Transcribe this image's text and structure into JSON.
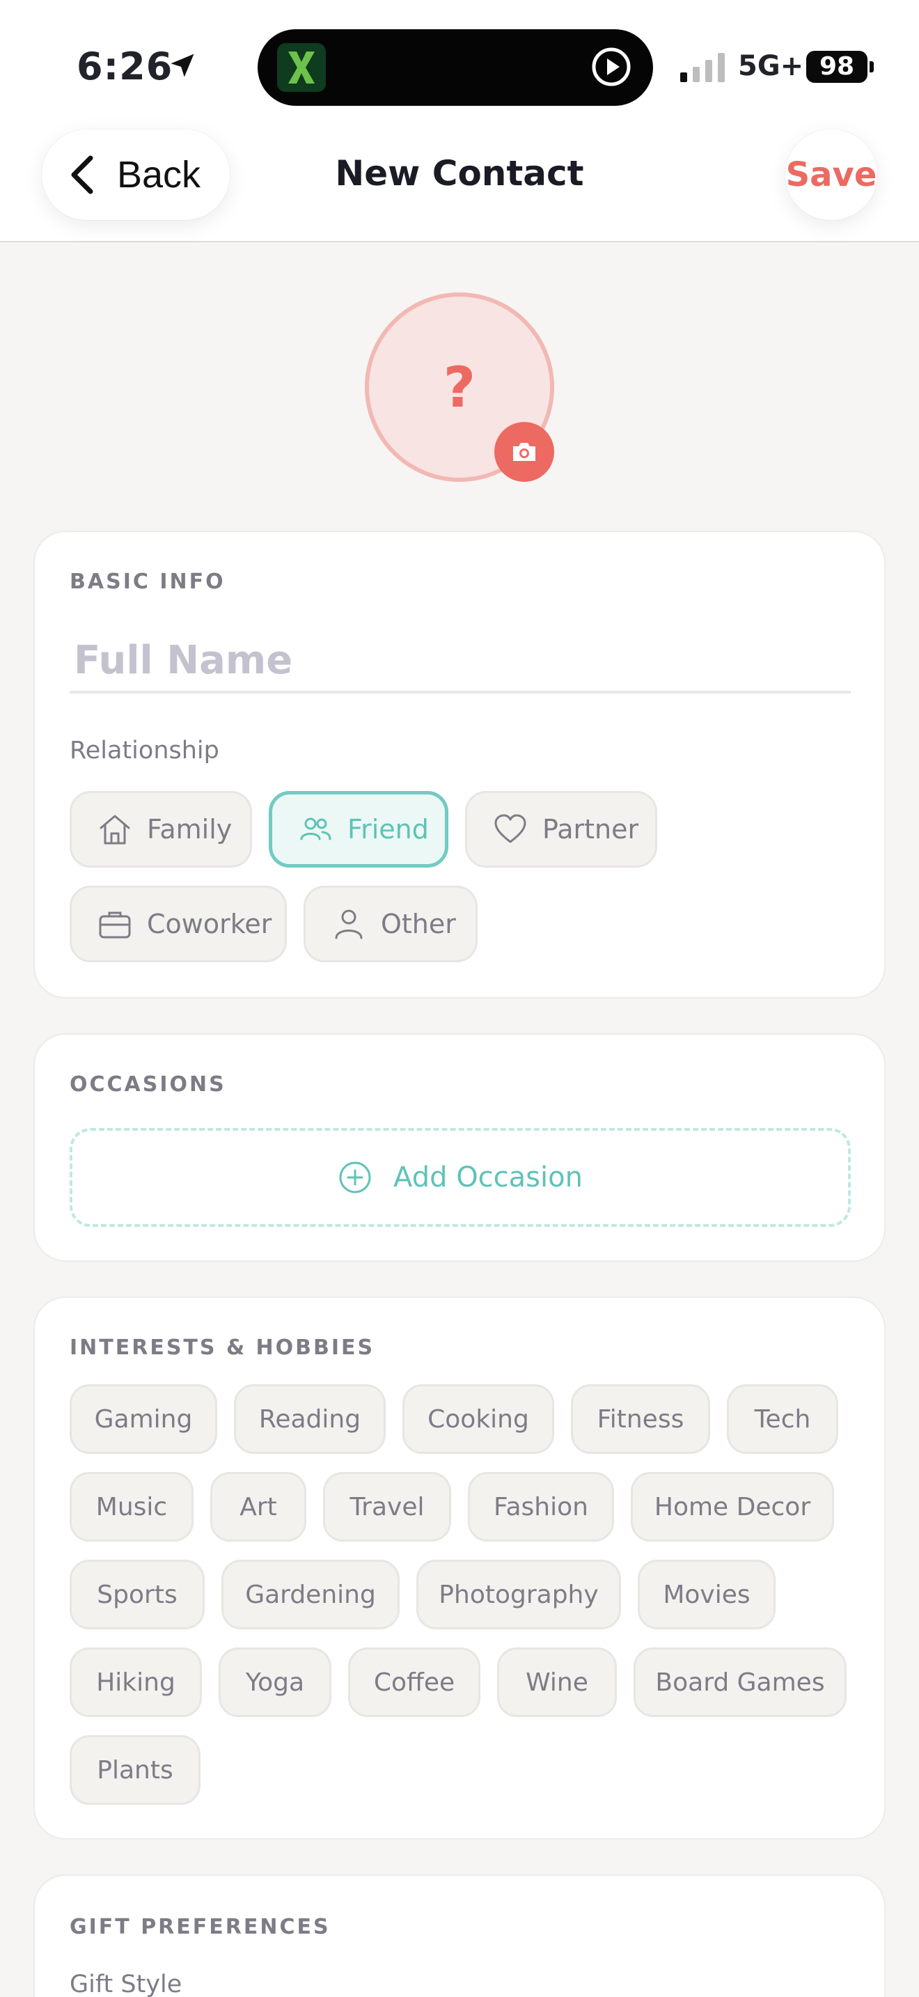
{
  "status_bar": {
    "time": "6:26",
    "network": "5G+",
    "battery": "98"
  },
  "nav": {
    "back_label": "Back",
    "title": "New Contact",
    "save_label": "Save"
  },
  "avatar": {
    "placeholder_glyph": "?"
  },
  "basic_info": {
    "section_title": "BASIC INFO",
    "full_name_placeholder": "Full Name",
    "full_name_value": "",
    "relationship_label": "Relationship",
    "relationships": [
      {
        "label": "Family",
        "icon": "home-icon",
        "selected": false
      },
      {
        "label": "Friend",
        "icon": "people-icon",
        "selected": true
      },
      {
        "label": "Partner",
        "icon": "heart-icon",
        "selected": false
      },
      {
        "label": "Coworker",
        "icon": "briefcase-icon",
        "selected": false
      },
      {
        "label": "Other",
        "icon": "person-icon",
        "selected": false
      }
    ]
  },
  "occasions": {
    "section_title": "OCCASIONS",
    "add_label": "Add Occasion"
  },
  "interests": {
    "section_title": "INTERESTS & HOBBIES",
    "tags": [
      "Gaming",
      "Reading",
      "Cooking",
      "Fitness",
      "Tech",
      "Music",
      "Art",
      "Travel",
      "Fashion",
      "Home Decor",
      "Sports",
      "Gardening",
      "Photography",
      "Movies",
      "Hiking",
      "Yoga",
      "Coffee",
      "Wine",
      "Board Games",
      "Plants"
    ]
  },
  "gift_preferences": {
    "section_title": "GIFT PREFERENCES",
    "gift_style_label": "Gift Style"
  },
  "colors": {
    "accent_teal": "#5ec3b6",
    "accent_coral": "#ec6a62",
    "background": "#f6f5f3"
  }
}
